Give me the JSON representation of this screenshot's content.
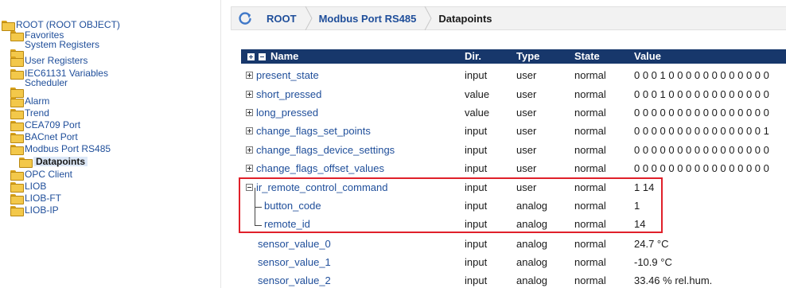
{
  "tree": {
    "items": [
      {
        "label": "ROOT (ROOT OBJECT)",
        "depth": 0
      },
      {
        "label": "Favorites",
        "depth": 1
      },
      {
        "label": "System Registers",
        "depth": 1
      },
      {
        "label": "User Registers",
        "depth": 1
      },
      {
        "label": "IEC61131 Variables",
        "depth": 1
      },
      {
        "label": "Scheduler",
        "depth": 1
      },
      {
        "label": "Alarm",
        "depth": 1
      },
      {
        "label": "Trend",
        "depth": 1
      },
      {
        "label": "CEA709 Port",
        "depth": 1
      },
      {
        "label": "BACnet Port",
        "depth": 1
      },
      {
        "label": "Modbus Port RS485",
        "depth": 1
      },
      {
        "label": "Datapoints",
        "depth": 2,
        "selected": true
      },
      {
        "label": "OPC Client",
        "depth": 1
      },
      {
        "label": "LIOB",
        "depth": 1
      },
      {
        "label": "LIOB-FT",
        "depth": 1
      },
      {
        "label": "LIOB-IP",
        "depth": 1
      }
    ]
  },
  "breadcrumb": {
    "items": [
      "ROOT",
      "Modbus Port RS485",
      "Datapoints"
    ]
  },
  "table": {
    "headers": {
      "name": "Name",
      "dir": "Dir.",
      "type": "Type",
      "state": "State",
      "value": "Value"
    },
    "rows": [
      {
        "name": "present_state",
        "dir": "input",
        "type": "user",
        "state": "normal",
        "value": "0 0 0 1 0 0 0 0 0 0 0 0 0 0 0 0"
      },
      {
        "name": "short_pressed",
        "dir": "value",
        "type": "user",
        "state": "normal",
        "value": "0 0 0 1 0 0 0 0 0 0 0 0 0 0 0 0"
      },
      {
        "name": "long_pressed",
        "dir": "value",
        "type": "user",
        "state": "normal",
        "value": "0 0 0 0 0 0 0 0 0 0 0 0 0 0 0 0"
      },
      {
        "name": "change_flags_set_points",
        "dir": "input",
        "type": "user",
        "state": "normal",
        "value": "0 0 0 0 0 0 0 0 0 0 0 0 0 0 0 1"
      },
      {
        "name": "change_flags_device_settings",
        "dir": "input",
        "type": "user",
        "state": "normal",
        "value": "0 0 0 0 0 0 0 0 0 0 0 0 0 0 0 0"
      },
      {
        "name": "change_flags_offset_values",
        "dir": "input",
        "type": "user",
        "state": "normal",
        "value": "0 0 0 0 0 0 0 0 0 0 0 0 0 0 0 0"
      },
      {
        "name": "ir_remote_control_command",
        "dir": "input",
        "type": "user",
        "state": "normal",
        "value": "1 14"
      },
      {
        "name": "button_code",
        "dir": "input",
        "type": "analog",
        "state": "normal",
        "value": "1"
      },
      {
        "name": "remote_id",
        "dir": "input",
        "type": "analog",
        "state": "normal",
        "value": "14"
      },
      {
        "name": "sensor_value_0",
        "dir": "input",
        "type": "analog",
        "state": "normal",
        "value": "24.7 °C"
      },
      {
        "name": "sensor_value_1",
        "dir": "input",
        "type": "analog",
        "state": "normal",
        "value": "-10.9 °C"
      },
      {
        "name": "sensor_value_2",
        "dir": "input",
        "type": "analog",
        "state": "normal",
        "value": "33.46 % rel.hum."
      }
    ]
  },
  "colors": {
    "header_bg": "#17376b",
    "link": "#1f4e9a",
    "highlight_border": "#e0202a",
    "folder": "#f3c84a"
  }
}
